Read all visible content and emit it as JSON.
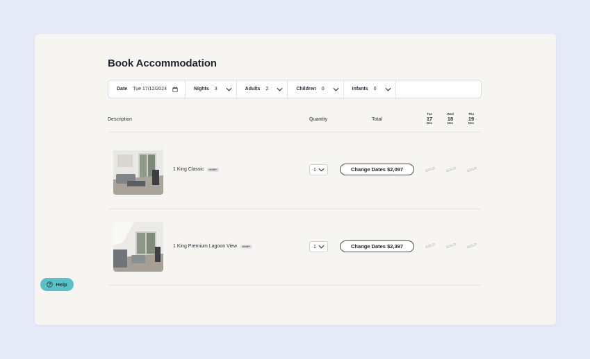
{
  "page": {
    "title": "Book Accommodation"
  },
  "filters": {
    "date_label": "Date",
    "date_value": "Tue 17/12/2024",
    "nights_label": "Nights",
    "nights_value": "3",
    "adults_label": "Adults",
    "adults_value": "2",
    "children_label": "Children",
    "children_value": "0",
    "infants_label": "Infants",
    "infants_value": "0"
  },
  "table": {
    "headers": {
      "description": "Description",
      "quantity": "Quantity",
      "total": "Total"
    },
    "days": [
      {
        "weekday": "Tue",
        "day": "17",
        "month": "Dec"
      },
      {
        "weekday": "Wed",
        "day": "18",
        "month": "Dec"
      },
      {
        "weekday": "Thu",
        "day": "19",
        "month": "Dec"
      }
    ],
    "rows": [
      {
        "name": "1 King Classic",
        "badge": "HOME+",
        "quantity": "1",
        "button": "Change Dates $2,097",
        "availability": [
          "SOLD",
          "SOLD",
          "SOLD"
        ]
      },
      {
        "name": "1 King Premium Lagoon View",
        "badge": "HOME+",
        "quantity": "1",
        "button": "Change Dates $2,397",
        "availability": [
          "SOLD",
          "SOLD",
          "SOLD"
        ]
      }
    ]
  },
  "help": {
    "label": "Help"
  },
  "colors": {
    "background": "#e5eaf9",
    "card": "#f6f5f2",
    "help_button": "#5cc1c6",
    "sold_text": "#bdbdc2"
  },
  "icons": [
    "calendar-icon",
    "chevron-down-icon",
    "question-circle-icon"
  ]
}
